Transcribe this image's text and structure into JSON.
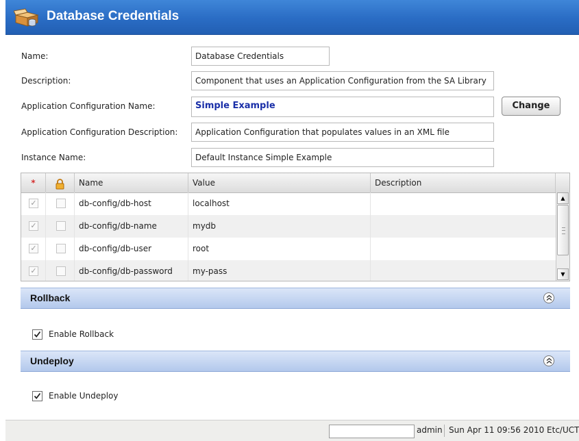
{
  "window": {
    "title": "Database Credentials",
    "icon": "package-database-icon"
  },
  "form": {
    "name_label": "Name:",
    "name_value": "Database Credentials",
    "description_label": "Description:",
    "description_value": "Component that uses an Application Configuration from the SA Library",
    "app_config_name_label": "Application Configuration Name:",
    "app_config_name_value": "Simple Example",
    "change_button": "Change",
    "app_config_desc_label": "Application Configuration Description:",
    "app_config_desc_value": "Application Configuration that populates values in an XML file",
    "instance_name_label": "Instance Name:",
    "instance_name_value": "Default Instance Simple Example"
  },
  "table": {
    "required_marker": "*",
    "lock_icon": "lock-icon",
    "columns": [
      "Name",
      "Value",
      "Description"
    ],
    "rows": [
      {
        "name": "db-config/db-host",
        "value": "localhost",
        "description": "",
        "required": true,
        "locked": false
      },
      {
        "name": "db-config/db-name",
        "value": "mydb",
        "description": "",
        "required": true,
        "locked": false
      },
      {
        "name": "db-config/db-user",
        "value": "root",
        "description": "",
        "required": true,
        "locked": false
      },
      {
        "name": "db-config/db-password",
        "value": "my-pass",
        "description": "",
        "required": true,
        "locked": false
      }
    ]
  },
  "rollback": {
    "title": "Rollback",
    "checkbox_label": "Enable Rollback",
    "checked": true
  },
  "undeploy": {
    "title": "Undeploy",
    "checkbox_label": "Enable Undeploy",
    "checked": true
  },
  "status": {
    "user": "admin",
    "datetime": "Sun Apr 11 09:56 2010 Etc/UCT"
  },
  "colors": {
    "title_bar": "#2a6cc4",
    "section_header": "#b3c9ec",
    "accent_text": "#1a2fa8"
  }
}
